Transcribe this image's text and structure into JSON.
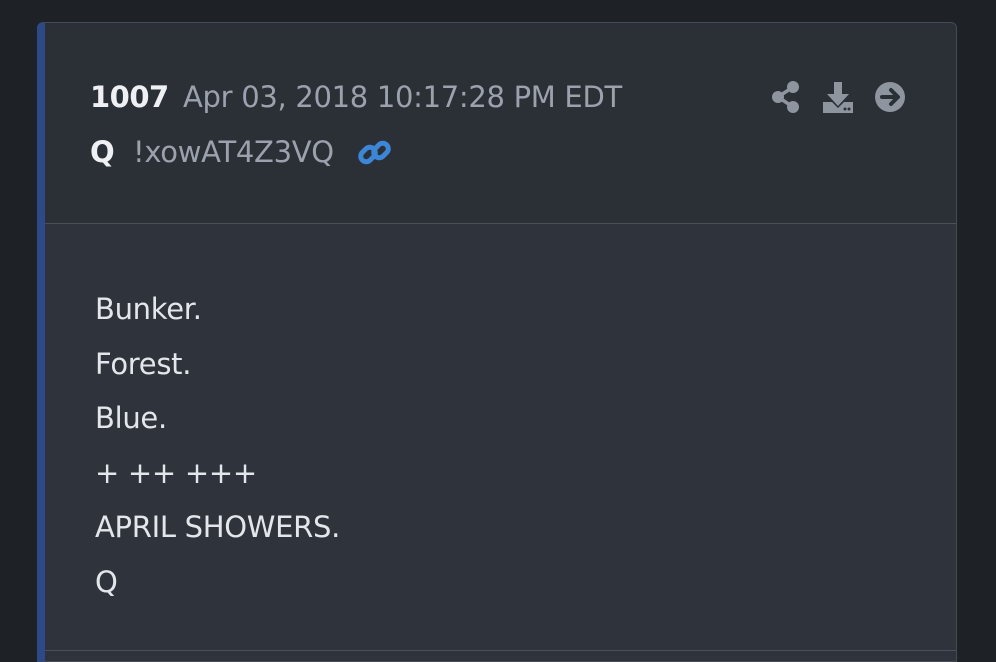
{
  "post": {
    "number": "1007",
    "timestamp": "Apr 03, 2018 10:17:28 PM EDT",
    "author": "Q",
    "tripcode": "!xowAT4Z3VQ",
    "lines": [
      "Bunker.",
      "Forest.",
      "Blue.",
      "+ ++ +++",
      "APRIL SHOWERS.",
      "Q"
    ]
  },
  "icons": {
    "link": "link-icon",
    "share": "share-icon",
    "download": "download-icon",
    "next": "arrow-right-circle-icon"
  },
  "colors": {
    "page_background": "#1e2126",
    "card_header": "#2b2f36",
    "card_body": "#2f343c",
    "accent_bar": "#2d4a86",
    "link_icon": "#3d86d6",
    "action_icons": "#8e959f",
    "primary_text": "#eef0f3",
    "secondary_text": "#9ba2ad"
  }
}
